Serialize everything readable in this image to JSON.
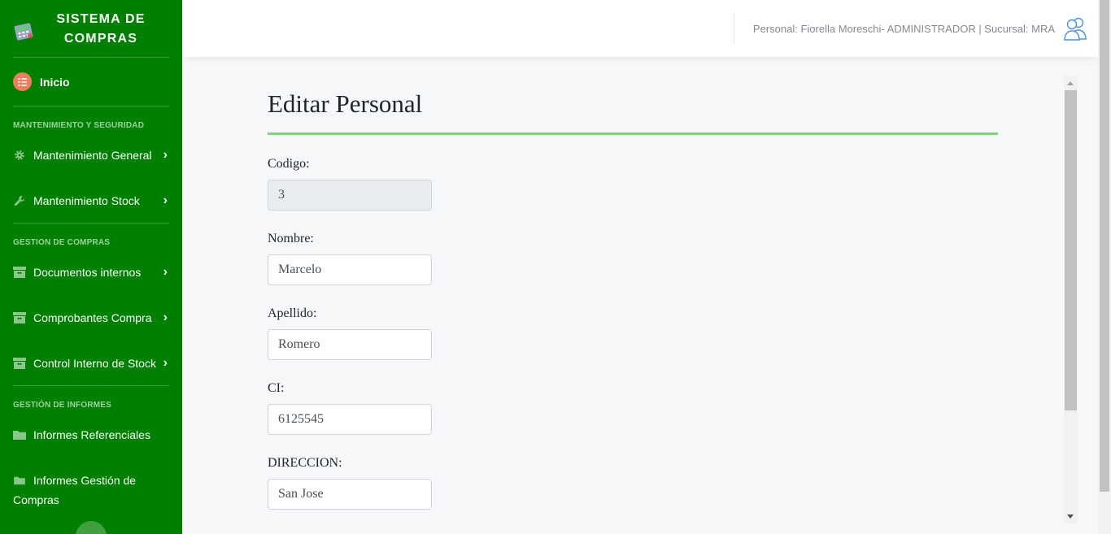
{
  "sidebar": {
    "brand_line1": "SISTEMA DE",
    "brand_line2": "COMPRAS",
    "home_label": "Inicio",
    "section1": "MANTENIMIENTO Y SEGURIDAD",
    "mant_general": "Mantenimiento General",
    "mant_stock": "Mantenimiento Stock",
    "section2": "GESTION DE COMPRAS",
    "doc_internos": "Documentos internos",
    "comprobantes": "Comprobantes Compra",
    "control_stock": "Control Interno de Stock",
    "section3": "GESTIÓN DE INFORMES",
    "inf_referenciales": "Informes Referenciales",
    "inf_gestion": "Informes Gestión de Compras",
    "chevron": "›"
  },
  "topbar": {
    "user_info": "Personal: Fiorella Moreschi- ADMINISTRADOR | Sucursal: MRA"
  },
  "form": {
    "title": "Editar Personal",
    "codigo_label": "Codigo:",
    "codigo_value": "3",
    "nombre_label": "Nombre:",
    "nombre_value": "Marcelo",
    "apellido_label": "Apellido:",
    "apellido_value": "Romero",
    "ci_label": "CI:",
    "ci_value": "6125545",
    "direccion_label": "DIRECCION:",
    "direccion_value": "San Jose"
  },
  "colors": {
    "sidebar_bg": "#008000",
    "accent_rule": "#7cd47c",
    "page_bg": "#f6f7f9"
  },
  "icons": {
    "brand": "calculator-icon",
    "home": "home-dashboard-icon",
    "mant_general": "gear-icon",
    "mant_stock": "wrench-icon",
    "documents": "archive-box-icon",
    "reports": "folder-icon",
    "user": "users-icon"
  }
}
